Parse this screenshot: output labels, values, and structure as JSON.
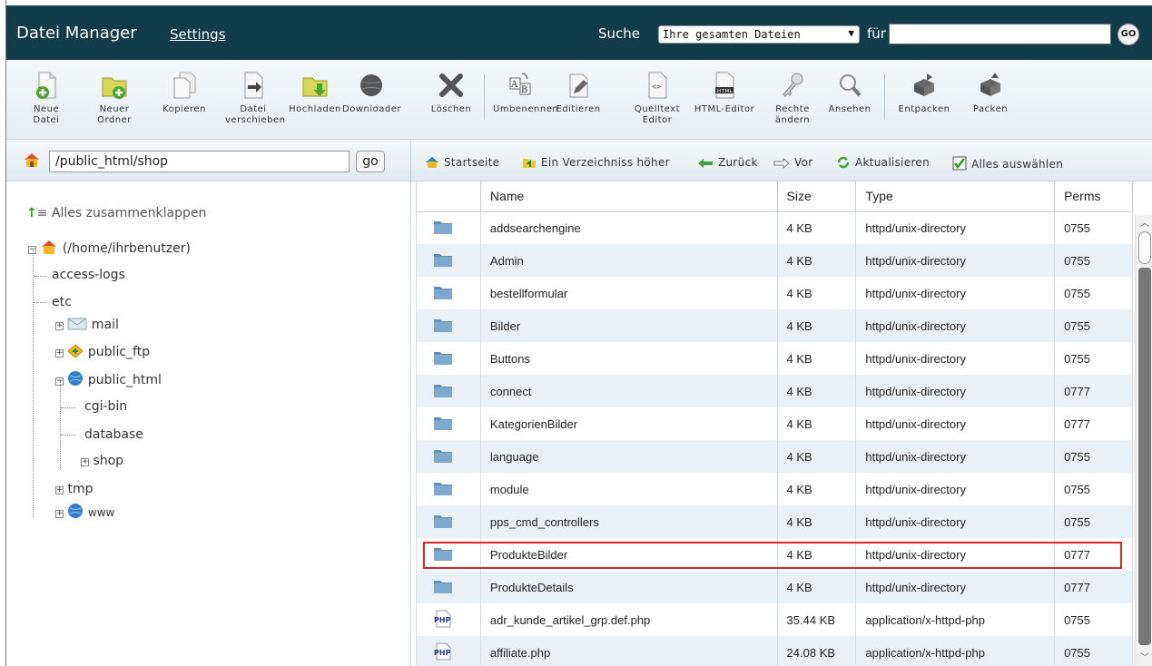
{
  "header": {
    "title": "Datei Manager",
    "settings": "Settings",
    "search_label": "Suche",
    "search_scope": "Ihre gesamten Dateien",
    "search_for": "für",
    "search_value": "",
    "go": "GO"
  },
  "toolbar": {
    "new_file": [
      "Neue",
      "Datei"
    ],
    "new_folder": [
      "Neuer",
      "Ordner"
    ],
    "copy": [
      "Kopieren"
    ],
    "move": [
      "Datei",
      "verschieben"
    ],
    "upload": [
      "Hochladen"
    ],
    "download": [
      "Downloader"
    ],
    "delete": [
      "Löschen"
    ],
    "rename": [
      "Umbenennen"
    ],
    "edit": [
      "Editieren"
    ],
    "source_editor": [
      "Quelltext",
      "Editor"
    ],
    "html_editor": [
      "HTML-Editor"
    ],
    "permissions": [
      "Rechte",
      "ändern"
    ],
    "view": [
      "Ansehen"
    ],
    "extract": [
      "Entpacken"
    ],
    "compress": [
      "Packen"
    ]
  },
  "pathbar": {
    "path": "/public_html/shop",
    "go": "go"
  },
  "navbar": {
    "home": "Startseite",
    "up": "Ein Verzeichniss höher",
    "back": "Zurück",
    "forward": "Vor",
    "reload": "Aktualisieren",
    "select_all": "Alles auswählen"
  },
  "tree": {
    "collapse_all": "Alles zusammenklappen",
    "root": "(/home/ihrbenutzer)",
    "access_logs": "access-logs",
    "etc": "etc",
    "mail": "mail",
    "public_ftp": "public_ftp",
    "public_html": "public_html",
    "cgi_bin": "cgi-bin",
    "database": "database",
    "shop": "shop",
    "tmp": "tmp",
    "www": "www"
  },
  "table": {
    "columns": {
      "name": "Name",
      "size": "Size",
      "type": "Type",
      "perms": "Perms"
    },
    "rows": [
      {
        "icon": "folder-icon",
        "name": "addsearchengine",
        "size": "4 KB",
        "type": "httpd/unix-directory",
        "perms": "0755"
      },
      {
        "icon": "folder-icon",
        "name": "Admin",
        "size": "4 KB",
        "type": "httpd/unix-directory",
        "perms": "0755"
      },
      {
        "icon": "folder-icon",
        "name": "bestellformular",
        "size": "4 KB",
        "type": "httpd/unix-directory",
        "perms": "0755"
      },
      {
        "icon": "folder-icon",
        "name": "Bilder",
        "size": "4 KB",
        "type": "httpd/unix-directory",
        "perms": "0755"
      },
      {
        "icon": "folder-icon",
        "name": "Buttons",
        "size": "4 KB",
        "type": "httpd/unix-directory",
        "perms": "0755"
      },
      {
        "icon": "folder-icon",
        "name": "connect",
        "size": "4 KB",
        "type": "httpd/unix-directory",
        "perms": "0777"
      },
      {
        "icon": "folder-icon",
        "name": "KategorienBilder",
        "size": "4 KB",
        "type": "httpd/unix-directory",
        "perms": "0777"
      },
      {
        "icon": "folder-icon",
        "name": "language",
        "size": "4 KB",
        "type": "httpd/unix-directory",
        "perms": "0755"
      },
      {
        "icon": "folder-icon",
        "name": "module",
        "size": "4 KB",
        "type": "httpd/unix-directory",
        "perms": "0755"
      },
      {
        "icon": "folder-icon",
        "name": "pps_cmd_controllers",
        "size": "4 KB",
        "type": "httpd/unix-directory",
        "perms": "0755"
      },
      {
        "icon": "folder-icon",
        "name": "ProdukteBilder",
        "size": "4 KB",
        "type": "httpd/unix-directory",
        "perms": "0777"
      },
      {
        "icon": "folder-icon",
        "name": "ProdukteDetails",
        "size": "4 KB",
        "type": "httpd/unix-directory",
        "perms": "0777"
      },
      {
        "icon": "php-icon",
        "name": "adr_kunde_artikel_grp.def.php",
        "size": "35.44 KB",
        "type": "application/x-httpd-php",
        "perms": "0755"
      },
      {
        "icon": "php-icon",
        "name": "affiliate.php",
        "size": "24.08 KB",
        "type": "application/x-httpd-php",
        "perms": "0755"
      }
    ]
  },
  "colors": {
    "header_bg": "#123c49",
    "highlight": "#d9262c",
    "row_alt": "#eaf1f6"
  }
}
